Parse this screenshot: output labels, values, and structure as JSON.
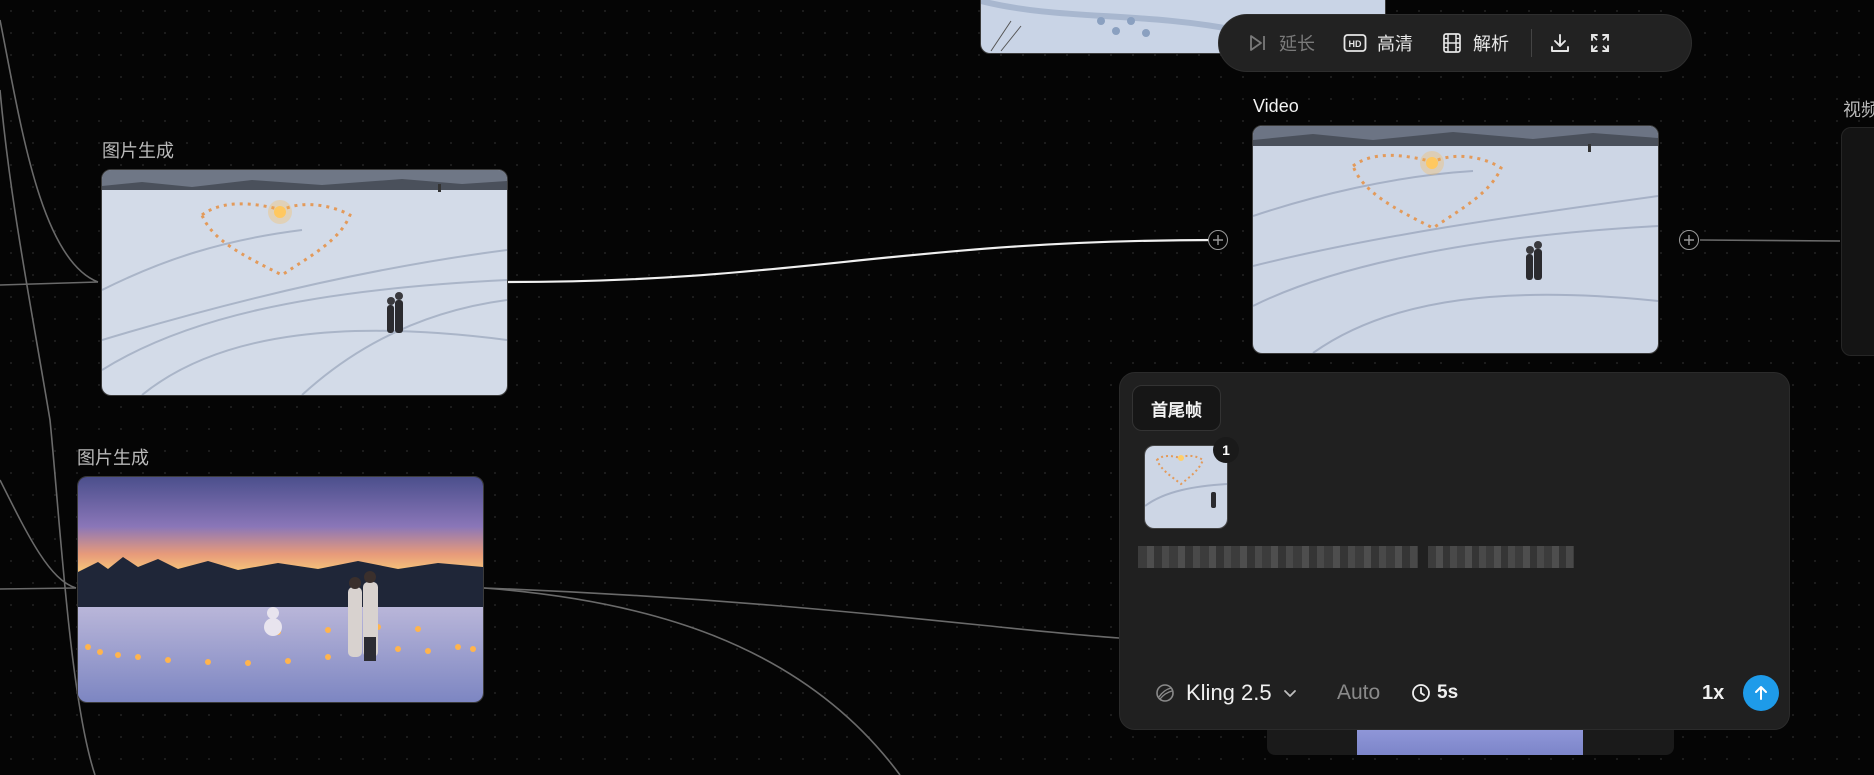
{
  "toolbar": {
    "extend_label": "延长",
    "hd_label": "高清",
    "analyze_label": "解析"
  },
  "nodes": {
    "image_node_1_label": "图片生成",
    "image_node_2_label": "图片生成",
    "video_node_label": "Video",
    "video_right_label": "视频"
  },
  "panel": {
    "mode_chip": "首尾帧",
    "frame_badge": "1",
    "model_name": "Kling 2.5",
    "aspect": "Auto",
    "duration": "5s",
    "count": "1x"
  },
  "colors": {
    "accent": "#1e9be9",
    "panel_bg": "#202020",
    "canvas_bg": "#050505"
  }
}
